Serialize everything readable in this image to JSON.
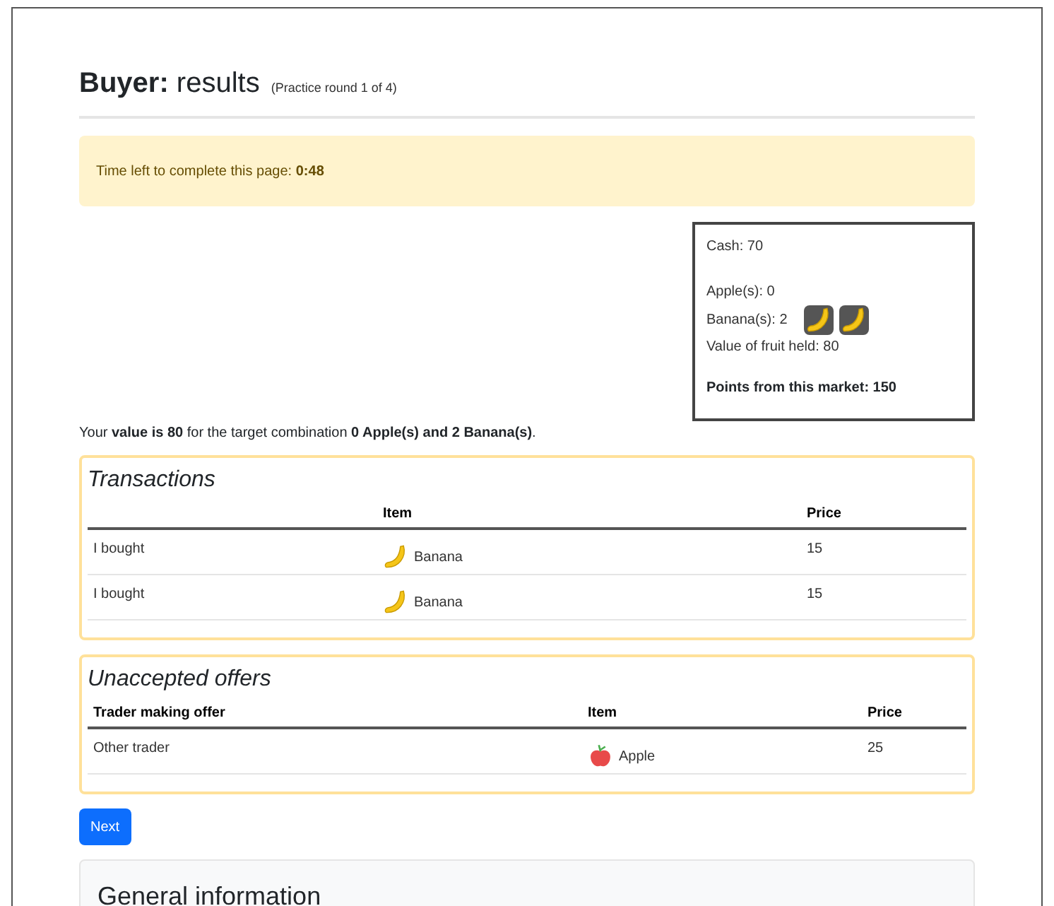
{
  "header": {
    "role": "Buyer:",
    "title": "results",
    "subtitle": "(Practice round 1 of 4)"
  },
  "timer": {
    "label": "Time left to complete this page:",
    "value": "0:48"
  },
  "summary": {
    "cash": "Cash: 70",
    "holdings": [
      {
        "label": "Apple(s): 0"
      },
      {
        "label": "Banana(s): 2",
        "icons": [
          {
            "kind": "banana"
          },
          {
            "kind": "banana"
          }
        ]
      }
    ],
    "value_held": "Value of fruit held: 80",
    "points": "Points from this market: 150"
  },
  "value_sentence": "Your **value is 80** for the target combination **0 Apple(s) and 2 Banana(s)**.",
  "transactions": {
    "title": "Transactions",
    "columns": [
      "",
      "Item",
      "Price"
    ],
    "rows": [
      {
        "action": "I bought",
        "item": "Banana",
        "kind": "banana",
        "price": "15"
      },
      {
        "action": "I bought",
        "item": "Banana",
        "kind": "banana",
        "price": "15"
      }
    ]
  },
  "offers": {
    "title": "Unaccepted offers",
    "columns": [
      "Trader making offer",
      "Item",
      "Price"
    ],
    "rows": [
      {
        "action": "Other trader",
        "item": "Apple",
        "kind": "apple",
        "price": "25"
      }
    ]
  },
  "next_button": "Next",
  "general_info": {
    "title": "General information"
  }
}
